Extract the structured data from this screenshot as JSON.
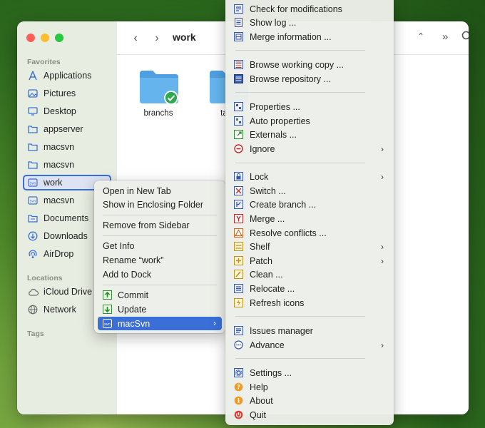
{
  "window": {
    "title": "work"
  },
  "sidebar": {
    "favorites_heading": "Favorites",
    "locations_heading": "Locations",
    "tags_heading": "Tags",
    "items": [
      {
        "label": "Applications",
        "icon": "applications-icon"
      },
      {
        "label": "Pictures",
        "icon": "pictures-icon"
      },
      {
        "label": "Desktop",
        "icon": "desktop-icon"
      },
      {
        "label": "appserver",
        "icon": "folder-icon"
      },
      {
        "label": "macsvn",
        "icon": "folder-icon"
      },
      {
        "label": "macsvn",
        "icon": "folder-icon"
      },
      {
        "label": "work",
        "icon": "svn-folder-icon",
        "selected": true
      },
      {
        "label": "macsvn",
        "icon": "svn-folder-icon"
      },
      {
        "label": "Documents",
        "icon": "documents-icon"
      },
      {
        "label": "Downloads",
        "icon": "downloads-icon"
      },
      {
        "label": "AirDrop",
        "icon": "airdrop-icon"
      }
    ],
    "locations": [
      {
        "label": "iCloud Drive",
        "icon": "icloud-icon"
      },
      {
        "label": "Network",
        "icon": "network-icon"
      }
    ]
  },
  "content": {
    "folders": [
      {
        "label": "branchs",
        "status": "up-to-date"
      },
      {
        "label": "tags"
      }
    ]
  },
  "context_menu": {
    "items": [
      "Open in New Tab",
      "Show in Enclosing Folder",
      "Remove from Sidebar",
      "Get Info",
      "Rename “work”",
      "Add to Dock",
      "Commit",
      "Update",
      "macSvn"
    ]
  },
  "submenu": {
    "items": [
      {
        "label": "Check for modifications",
        "icon": "check-modifications-icon"
      },
      {
        "label": "Show log ...",
        "icon": "show-log-icon"
      },
      {
        "label": "Merge information ...",
        "icon": "merge-info-icon"
      },
      {
        "label": "Browse working copy ...",
        "icon": "browse-wc-icon"
      },
      {
        "label": "Browse repository ...",
        "icon": "browse-repo-icon"
      },
      {
        "label": "Properties ...",
        "icon": "properties-icon"
      },
      {
        "label": "Auto properties",
        "icon": "auto-properties-icon"
      },
      {
        "label": "Externals ...",
        "icon": "externals-icon"
      },
      {
        "label": "Ignore",
        "icon": "ignore-icon",
        "submenu": true
      },
      {
        "label": "Lock",
        "icon": "lock-icon",
        "submenu": true
      },
      {
        "label": "Switch ...",
        "icon": "switch-icon"
      },
      {
        "label": "Create branch ...",
        "icon": "branch-icon"
      },
      {
        "label": "Merge ...",
        "icon": "merge-icon"
      },
      {
        "label": "Resolve conflicts ...",
        "icon": "resolve-icon"
      },
      {
        "label": "Shelf",
        "icon": "shelf-icon",
        "submenu": true
      },
      {
        "label": "Patch",
        "icon": "patch-icon",
        "submenu": true
      },
      {
        "label": "Clean ...",
        "icon": "clean-icon"
      },
      {
        "label": "Relocate ...",
        "icon": "relocate-icon"
      },
      {
        "label": "Refresh icons",
        "icon": "refresh-icon"
      },
      {
        "label": "Issues manager",
        "icon": "issues-icon"
      },
      {
        "label": "Advance",
        "icon": "advance-icon",
        "submenu": true
      },
      {
        "label": "Settings ...",
        "icon": "settings-icon"
      },
      {
        "label": "Help",
        "icon": "help-icon"
      },
      {
        "label": "About",
        "icon": "about-icon"
      },
      {
        "label": "Quit",
        "icon": "quit-icon"
      }
    ]
  },
  "colors": {
    "accent": "#3a6fd8",
    "folder": "#5aa9e6",
    "status_ok": "#2fa84f"
  }
}
